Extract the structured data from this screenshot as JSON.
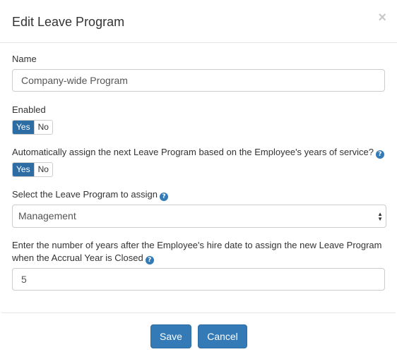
{
  "dialog": {
    "title": "Edit Leave Program",
    "close_glyph": "×"
  },
  "name": {
    "label": "Name",
    "value": "Company-wide Program"
  },
  "enabled": {
    "label": "Enabled",
    "yes": "Yes",
    "no": "No",
    "selected": "Yes"
  },
  "auto_assign": {
    "label": "Automatically assign the next Leave Program based on the Employee's years of service?",
    "yes": "Yes",
    "no": "No",
    "selected": "Yes"
  },
  "program_select": {
    "label": "Select the Leave Program to assign",
    "value": "Management"
  },
  "years": {
    "label_line1": "Enter the number of years after the Employee's hire date to assign the new Leave Program",
    "label_line2": "when the Accrual Year is Closed",
    "value": "5"
  },
  "footer": {
    "save": "Save",
    "cancel": "Cancel"
  },
  "colors": {
    "primary": "#337ab7",
    "toggle_active": "#2e6da4"
  },
  "icons": {
    "help": "?"
  }
}
